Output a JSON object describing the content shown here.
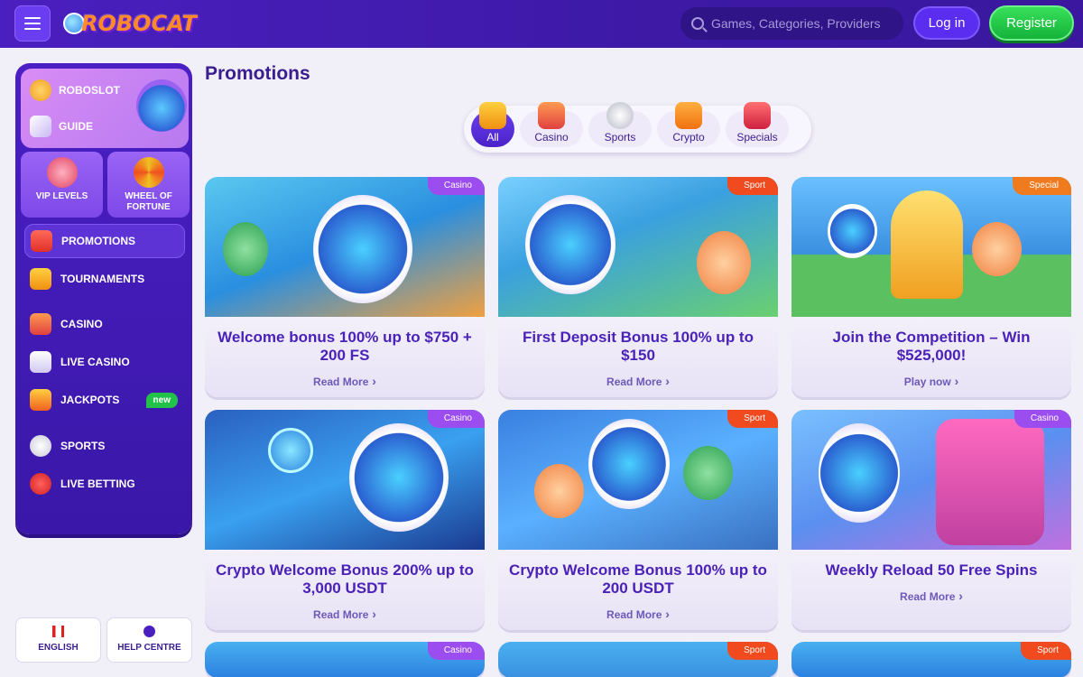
{
  "header": {
    "logo": "ROBOCAT",
    "search_placeholder": "Games, Categories, Providers",
    "login": "Log in",
    "register": "Register"
  },
  "sidebar": {
    "top_items": [
      {
        "label": "ROBOSLOT"
      },
      {
        "label": "GUIDE"
      }
    ],
    "tiles": [
      {
        "label": "VIP LEVELS"
      },
      {
        "label": "WHEEL OF FORTUNE"
      }
    ],
    "items": [
      {
        "label": "PROMOTIONS",
        "active": true
      },
      {
        "label": "TOURNAMENTS"
      },
      {
        "label": "CASINO"
      },
      {
        "label": "LIVE CASINO"
      },
      {
        "label": "JACKPOTS",
        "badge": "new"
      },
      {
        "label": "SPORTS"
      },
      {
        "label": "LIVE BETTING"
      }
    ]
  },
  "bottom": {
    "language": "ENGLISH",
    "help": "HELP CENTRE"
  },
  "page": {
    "title": "Promotions"
  },
  "filters": [
    "All",
    "Casino",
    "Sports",
    "Crypto",
    "Specials"
  ],
  "cards": [
    {
      "tag": "Casino",
      "title": "Welcome bonus 100% up to $750 + 200 FS",
      "link": "Read More"
    },
    {
      "tag": "Sport",
      "title": "First Deposit Bonus 100% up to $150",
      "link": "Read More"
    },
    {
      "tag": "Special",
      "title": "Join the Competition – Win $525,000!",
      "link": "Play now"
    },
    {
      "tag": "Casino",
      "title": "Crypto Welcome Bonus 200% up to 3,000 USDT",
      "link": "Read More"
    },
    {
      "tag": "Sport",
      "title": "Crypto Welcome Bonus 100% up to 200 USDT",
      "link": "Read More"
    },
    {
      "tag": "Casino",
      "title": "Weekly Reload 50 Free Spins",
      "link": "Read More"
    },
    {
      "tag": "Casino"
    },
    {
      "tag": "Sport"
    },
    {
      "tag": "Sport"
    }
  ],
  "colors": {
    "casino_tag": "#9b4df0",
    "sport_tag": "#f04a1e",
    "special_tag": "#f07a1e",
    "primary": "#4a1fbf",
    "register": "#1fc244"
  }
}
